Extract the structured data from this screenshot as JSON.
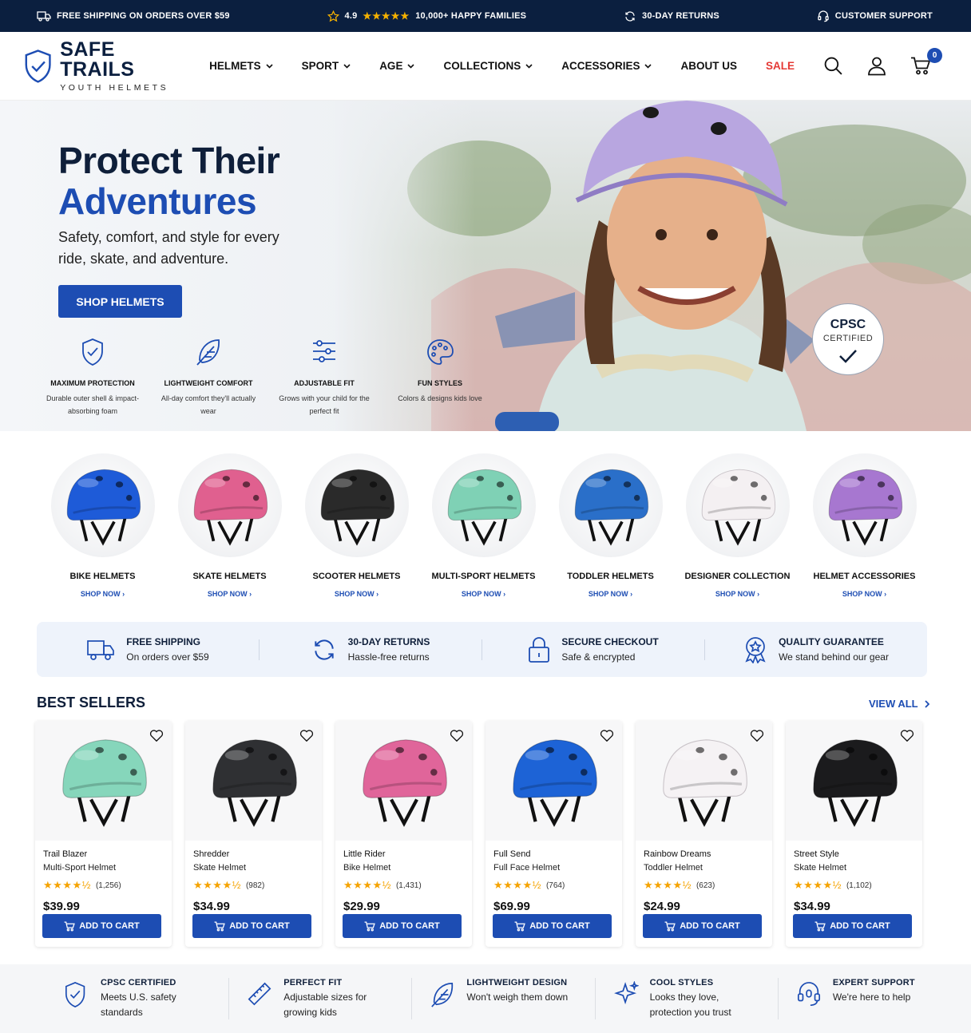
{
  "topbar": {
    "shipping": "FREE SHIPPING ON ORDERS OVER $59",
    "rating": "4.9",
    "stars": "★★★★★",
    "families": "10,000+ HAPPY FAMILIES",
    "returns": "30-DAY RETURNS",
    "support": "CUSTOMER SUPPORT"
  },
  "brand": {
    "name": "SAFE TRAILS",
    "tagline": "YOUTH HELMETS"
  },
  "nav": {
    "items": [
      "HELMETS",
      "SPORT",
      "AGE",
      "COLLECTIONS",
      "ACCESSORIES",
      "ABOUT US",
      "SALE"
    ],
    "cart_count": "0"
  },
  "hero": {
    "title_line1": "Protect Their",
    "title_line2": "Adventures",
    "subtitle": "Safety, comfort, and style for every ride, skate, and adventure.",
    "cta": "SHOP HELMETS",
    "badge_top": "CPSC",
    "badge_bottom": "CERTIFIED",
    "features": [
      {
        "title": "MAXIMUM PROTECTION",
        "desc": "Durable outer shell & impact-absorbing foam",
        "icon": "shield-check-icon"
      },
      {
        "title": "LIGHTWEIGHT COMFORT",
        "desc": "All-day comfort they'll actually wear",
        "icon": "feather-icon"
      },
      {
        "title": "ADJUSTABLE FIT",
        "desc": "Grows with your child for the perfect fit",
        "icon": "sliders-icon"
      },
      {
        "title": "FUN STYLES",
        "desc": "Colors & designs kids love",
        "icon": "palette-icon"
      }
    ]
  },
  "categories": [
    {
      "name": "BIKE HELMETS",
      "cta": "SHOP NOW ›",
      "color": "#1e5bd8"
    },
    {
      "name": "SKATE HELMETS",
      "cta": "SHOP NOW ›",
      "color": "#e0608f"
    },
    {
      "name": "SCOOTER HELMETS",
      "cta": "SHOP NOW ›",
      "color": "#2a2a2a"
    },
    {
      "name": "MULTI-SPORT HELMETS",
      "cta": "SHOP NOW ›",
      "color": "#7fd1b5"
    },
    {
      "name": "TODDLER HELMETS",
      "cta": "SHOP NOW ›",
      "color": "#2a6fc9"
    },
    {
      "name": "DESIGNER COLLECTION",
      "cta": "SHOP NOW ›",
      "color": "#f4f0f2"
    },
    {
      "name": "HELMET ACCESSORIES",
      "cta": "SHOP NOW ›",
      "color": "#a777d0"
    }
  ],
  "trust": [
    {
      "title": "FREE SHIPPING",
      "desc": "On orders over $59",
      "icon": "truck-icon"
    },
    {
      "title": "30-DAY RETURNS",
      "desc": "Hassle-free returns",
      "icon": "refresh-icon"
    },
    {
      "title": "SECURE CHECKOUT",
      "desc": "Safe & encrypted",
      "icon": "lock-icon"
    },
    {
      "title": "QUALITY GUARANTEE",
      "desc": "We stand behind our gear",
      "icon": "award-icon"
    }
  ],
  "best_sellers": {
    "title": "BEST SELLERS",
    "view_all": "VIEW ALL",
    "add_to_cart": "ADD TO CART",
    "products": [
      {
        "name": "Trail Blazer",
        "type": "Multi-Sport Helmet",
        "stars": "★★★★½",
        "reviews": "(1,256)",
        "price": "$39.99",
        "color": "#86d6bb"
      },
      {
        "name": "Shredder",
        "type": "Skate Helmet",
        "stars": "★★★★½",
        "reviews": "(982)",
        "price": "$34.99",
        "color": "#2f3033"
      },
      {
        "name": "Little Rider",
        "type": "Bike Helmet",
        "stars": "★★★★½",
        "reviews": "(1,431)",
        "price": "$29.99",
        "color": "#e0659a"
      },
      {
        "name": "Full Send",
        "type": "Full Face Helmet",
        "stars": "★★★★½",
        "reviews": "(764)",
        "price": "$69.99",
        "color": "#1d63d6"
      },
      {
        "name": "Rainbow Dreams",
        "type": "Toddler Helmet",
        "stars": "★★★★½",
        "reviews": "(623)",
        "price": "$24.99",
        "color": "#f5f2f4"
      },
      {
        "name": "Street Style",
        "type": "Skate Helmet",
        "stars": "★★★★½",
        "reviews": "(1,102)",
        "price": "$34.99",
        "color": "#1b1b1d"
      }
    ]
  },
  "footer_features": [
    {
      "title": "CPSC CERTIFIED",
      "desc": "Meets U.S. safety standards",
      "icon": "shield-check-icon"
    },
    {
      "title": "PERFECT FIT",
      "desc": "Adjustable sizes for growing kids",
      "icon": "ruler-icon"
    },
    {
      "title": "LIGHTWEIGHT DESIGN",
      "desc": "Won't weigh them down",
      "icon": "feather-icon"
    },
    {
      "title": "COOL STYLES",
      "desc": "Looks they love, protection you trust",
      "icon": "sparkle-icon"
    },
    {
      "title": "EXPERT SUPPORT",
      "desc": "We're here to help",
      "icon": "headset-icon"
    }
  ],
  "colors": {
    "navy": "#0b1f3f",
    "accent": "#1d4db3",
    "sale": "#e53935",
    "star": "#f5a300"
  }
}
